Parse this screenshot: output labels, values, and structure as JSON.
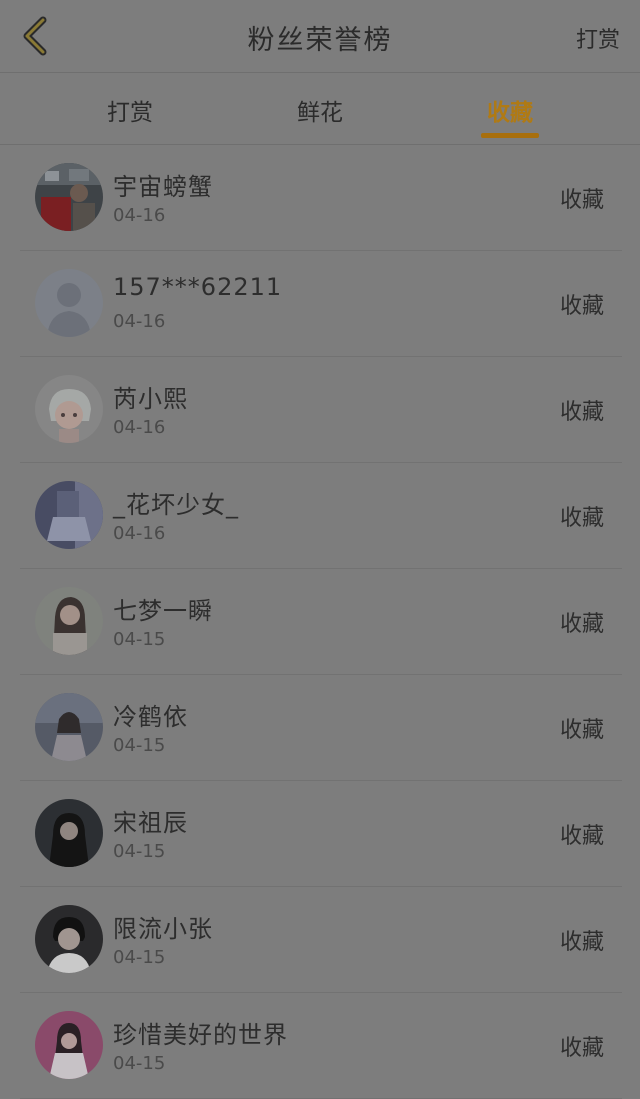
{
  "header": {
    "title": "粉丝荣誉榜",
    "right_action": "打赏"
  },
  "tabs": [
    {
      "label": "打赏",
      "active": false
    },
    {
      "label": "鲜花",
      "active": false
    },
    {
      "label": "收藏",
      "active": true
    }
  ],
  "colors": {
    "accent": "#a86f0e",
    "background": "#7d7d7d"
  },
  "list": [
    {
      "name": "宇宙螃蟹",
      "date": "04-16",
      "action": "收藏",
      "avatar": "avatar-photo-red-shirt"
    },
    {
      "name": "157***62211",
      "date": "04-16",
      "action": "收藏",
      "avatar": "avatar-default-placeholder"
    },
    {
      "name": "芮小熙",
      "date": "04-16",
      "action": "收藏",
      "avatar": "avatar-anime-girl"
    },
    {
      "name": "_花坏少女_",
      "date": "04-16",
      "action": "收藏",
      "avatar": "avatar-photo-girl-skirt"
    },
    {
      "name": "七梦一瞬",
      "date": "04-15",
      "action": "收藏",
      "avatar": "avatar-photo-girl-hand"
    },
    {
      "name": "冷鹤依",
      "date": "04-15",
      "action": "收藏",
      "avatar": "avatar-photo-girl-sitting"
    },
    {
      "name": "宋祖辰",
      "date": "04-15",
      "action": "收藏",
      "avatar": "avatar-photo-dark-girl"
    },
    {
      "name": "限流小张",
      "date": "04-15",
      "action": "收藏",
      "avatar": "avatar-photo-boy"
    },
    {
      "name": "珍惜美好的世界",
      "date": "04-15",
      "action": "收藏",
      "avatar": "avatar-photo-pink-girl"
    }
  ]
}
